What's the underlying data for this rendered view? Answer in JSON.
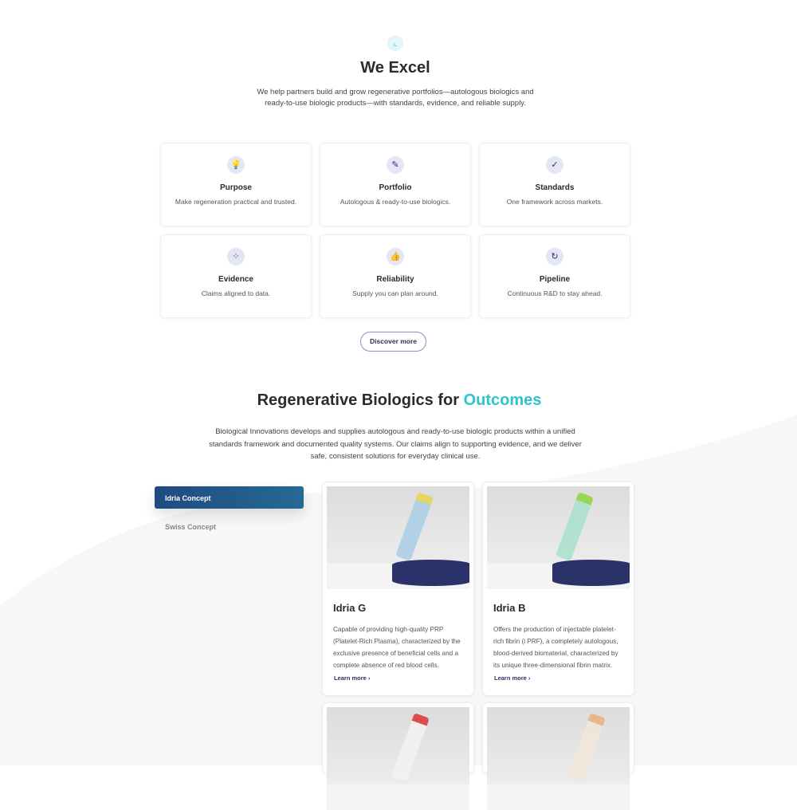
{
  "excel": {
    "icon": "chart-icon",
    "title": "We Excel",
    "subtitle": "We help partners build and grow regenerative portfolios—autologous biologics and ready-to-use biologic products—with standards, evidence, and reliable supply.",
    "cards": [
      {
        "icon": "lightbulb-icon",
        "glyph": "💡",
        "title": "Purpose",
        "text": "Make regeneration practical and trusted."
      },
      {
        "icon": "syringe-icon",
        "glyph": "✎",
        "title": "Portfolio",
        "text": "Autologous & ready-to-use biologics."
      },
      {
        "icon": "check-icon",
        "glyph": "✓",
        "title": "Standards",
        "text": "One framework across markets."
      },
      {
        "icon": "nodes-icon",
        "glyph": "⁘",
        "title": "Evidence",
        "text": "Claims aligned to data."
      },
      {
        "icon": "thumbs-up-icon",
        "glyph": "👍",
        "title": "Reliability",
        "text": "Supply you can plan around."
      },
      {
        "icon": "refresh-icon",
        "glyph": "↻",
        "title": "Pipeline",
        "text": "Continuous R&D to stay ahead."
      }
    ],
    "button": "Discover more"
  },
  "outcomes": {
    "title": "Regenerative Biologics for ",
    "title_accent": "Outcomes",
    "accent_color": "#2ec4cc",
    "text": "Biological Innovations develops and supplies autologous and ready-to-use biologic products within a unified standards framework and documented quality systems. Our claims align to supporting evidence, and we deliver safe, consistent solutions for everyday clinical use.",
    "tabs": [
      {
        "label": "Idria Concept",
        "active": true
      },
      {
        "label": "Swiss Concept",
        "active": false
      }
    ],
    "products": [
      {
        "name": "Idria G",
        "text": "Capable of providing high-quality PRP (Platelet-Rich Plasma), characterized by the exclusive presence of beneficial cells and a complete absence of red blood cells.",
        "link": "Learn more ›",
        "cap": "#e8d44a",
        "body": "#a9cde6"
      },
      {
        "name": "Idria B",
        "text": "Offers the production of injectable platelet-rich fibrin (i PRF), a completely autologous, blood-derived biomaterial, characterized by its unique three-dimensional fibrin matrix.",
        "link": "Learn more ›",
        "cap": "#8fd43a",
        "body": "#a8e0cc"
      }
    ]
  }
}
